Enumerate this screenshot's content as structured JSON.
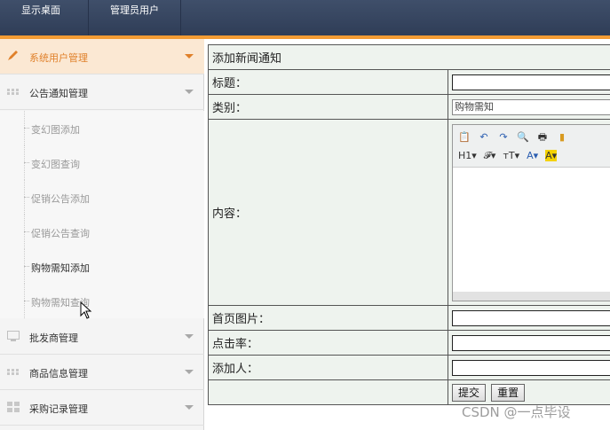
{
  "topbar": {
    "tabs": [
      "显示桌面",
      "管理员用户"
    ]
  },
  "sidebar": {
    "items": [
      {
        "label": "系统用户管理",
        "icon": "pencil-icon",
        "active": true
      },
      {
        "label": "公告通知管理",
        "icon": "dots-grid-icon",
        "active": false
      },
      {
        "label": "批发商管理",
        "icon": "monitor-icon",
        "active": false
      },
      {
        "label": "商品信息管理",
        "icon": "dots-grid-icon",
        "active": false
      },
      {
        "label": "采购记录管理",
        "icon": "grid-icon",
        "active": false
      }
    ],
    "subitems": [
      "变幻图添加",
      "变幻图查询",
      "促销公告添加",
      "促销公告查询",
      "购物需知添加",
      "购物需知查询"
    ]
  },
  "form": {
    "caption": "添加新闻通知",
    "title_label": "标题：",
    "category_label": "类别：",
    "category_value": "购物需知",
    "content_label": "内容：",
    "image_label": "首页图片：",
    "clickrate_label": "点击率：",
    "author_label": "添加人：",
    "submit_label": "提交",
    "reset_label": "重置"
  },
  "editor": {
    "row1": [
      "📋",
      "↶",
      "↷",
      "🔍",
      "🖶",
      "▮"
    ],
    "row2": [
      "H1▾",
      "𝓕▾",
      "ᴛT▾",
      "A▾",
      "A▾"
    ]
  },
  "watermark": "CSDN @一点毕设",
  "colors": {
    "accent": "#f39c34",
    "topbar": "#34425c"
  }
}
